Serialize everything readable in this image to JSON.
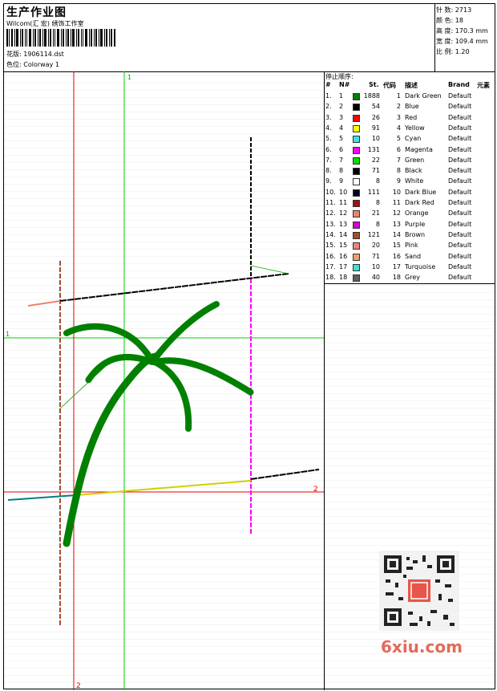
{
  "header": {
    "title": "生产作业图",
    "studio": "Wilcom(汇 宏) 绣饰工作室",
    "design_label": "花版:",
    "design_value": "1906114.dst",
    "colorway_label": "色位:",
    "colorway_value": "Colorway 1"
  },
  "stats": {
    "stitches_label": "针 数:",
    "stitches_value": "2713",
    "colors_label": "颜 色:",
    "colors_value": "18",
    "height_label": "高 度:",
    "height_value": "170.3 mm",
    "width_label": "宽 度:",
    "width_value": "109.4 mm",
    "scale_label": "比 例:",
    "scale_value": "1.20"
  },
  "stop_sequence": {
    "title": "停止顺序:",
    "columns": [
      "#",
      "N#",
      "St.",
      "代码",
      "描述",
      "Brand",
      "元素"
    ],
    "rows": [
      {
        "idx": "1.",
        "n": "1",
        "color": "#008000",
        "st": "1888",
        "code": "1",
        "desc": "Dark Green",
        "brand": "Default"
      },
      {
        "idx": "2.",
        "n": "2",
        "color": "#000000",
        "st": "54",
        "code": "2",
        "desc": "Blue",
        "brand": "Default"
      },
      {
        "idx": "3.",
        "n": "3",
        "color": "#ff0000",
        "st": "26",
        "code": "3",
        "desc": "Red",
        "brand": "Default"
      },
      {
        "idx": "4.",
        "n": "4",
        "color": "#ffff00",
        "st": "91",
        "code": "4",
        "desc": "Yellow",
        "brand": "Default"
      },
      {
        "idx": "5.",
        "n": "5",
        "color": "#40e0e0",
        "st": "10",
        "code": "5",
        "desc": "Cyan",
        "brand": "Default"
      },
      {
        "idx": "6.",
        "n": "6",
        "color": "#ff00ff",
        "st": "131",
        "code": "6",
        "desc": "Magenta",
        "brand": "Default"
      },
      {
        "idx": "7.",
        "n": "7",
        "color": "#00e000",
        "st": "22",
        "code": "7",
        "desc": "Green",
        "brand": "Default"
      },
      {
        "idx": "8.",
        "n": "8",
        "color": "#000000",
        "st": "71",
        "code": "8",
        "desc": "Black",
        "brand": "Default"
      },
      {
        "idx": "9.",
        "n": "9",
        "color": "#ffffff",
        "st": "8",
        "code": "9",
        "desc": "White",
        "brand": "Default"
      },
      {
        "idx": "10.",
        "n": "10",
        "color": "#000020",
        "st": "111",
        "code": "10",
        "desc": "Dark Blue",
        "brand": "Default"
      },
      {
        "idx": "11.",
        "n": "11",
        "color": "#a01010",
        "st": "8",
        "code": "11",
        "desc": "Dark Red",
        "brand": "Default"
      },
      {
        "idx": "12.",
        "n": "12",
        "color": "#f08070",
        "st": "21",
        "code": "12",
        "desc": "Orange",
        "brand": "Default"
      },
      {
        "idx": "13.",
        "n": "13",
        "color": "#d000d0",
        "st": "8",
        "code": "13",
        "desc": "Purple",
        "brand": "Default"
      },
      {
        "idx": "14.",
        "n": "14",
        "color": "#a05030",
        "st": "121",
        "code": "14",
        "desc": "Brown",
        "brand": "Default"
      },
      {
        "idx": "15.",
        "n": "15",
        "color": "#f08080",
        "st": "20",
        "code": "15",
        "desc": "Pink",
        "brand": "Default"
      },
      {
        "idx": "16.",
        "n": "16",
        "color": "#f0a070",
        "st": "71",
        "code": "16",
        "desc": "Sand",
        "brand": "Default"
      },
      {
        "idx": "17.",
        "n": "17",
        "color": "#40e0d0",
        "st": "10",
        "code": "17",
        "desc": "Turquoise",
        "brand": "Default"
      },
      {
        "idx": "18.",
        "n": "18",
        "color": "#606060",
        "st": "40",
        "code": "18",
        "desc": "Grey",
        "brand": "Default"
      }
    ]
  },
  "canvas": {
    "guide_label_1": "1",
    "guide_label_2": "2"
  },
  "watermark": {
    "site": "6xiu.com"
  }
}
